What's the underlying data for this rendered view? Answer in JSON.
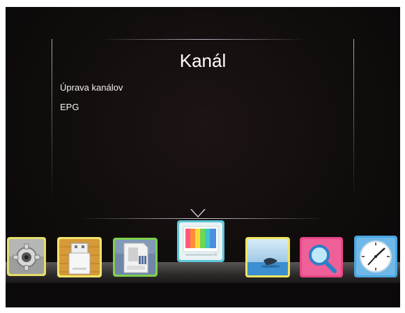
{
  "screen": {
    "title": "Kanál"
  },
  "menu": {
    "items": [
      {
        "label": "Úprava kanálov"
      },
      {
        "label": "EPG"
      }
    ]
  },
  "dock": {
    "icons": [
      {
        "name": "settings",
        "frame_color": "#e5de6a"
      },
      {
        "name": "usb-storage",
        "frame_color": "#f0e468"
      },
      {
        "name": "sd-card",
        "frame_color": "#7fcf4f"
      },
      {
        "name": "tv-channel",
        "frame_color": "#5cc6d8",
        "selected": true
      },
      {
        "name": "wallpaper",
        "frame_color": "#efe460"
      },
      {
        "name": "search",
        "frame_color": "#e84785"
      },
      {
        "name": "clock",
        "frame_color": "#4aa6e0"
      }
    ]
  }
}
